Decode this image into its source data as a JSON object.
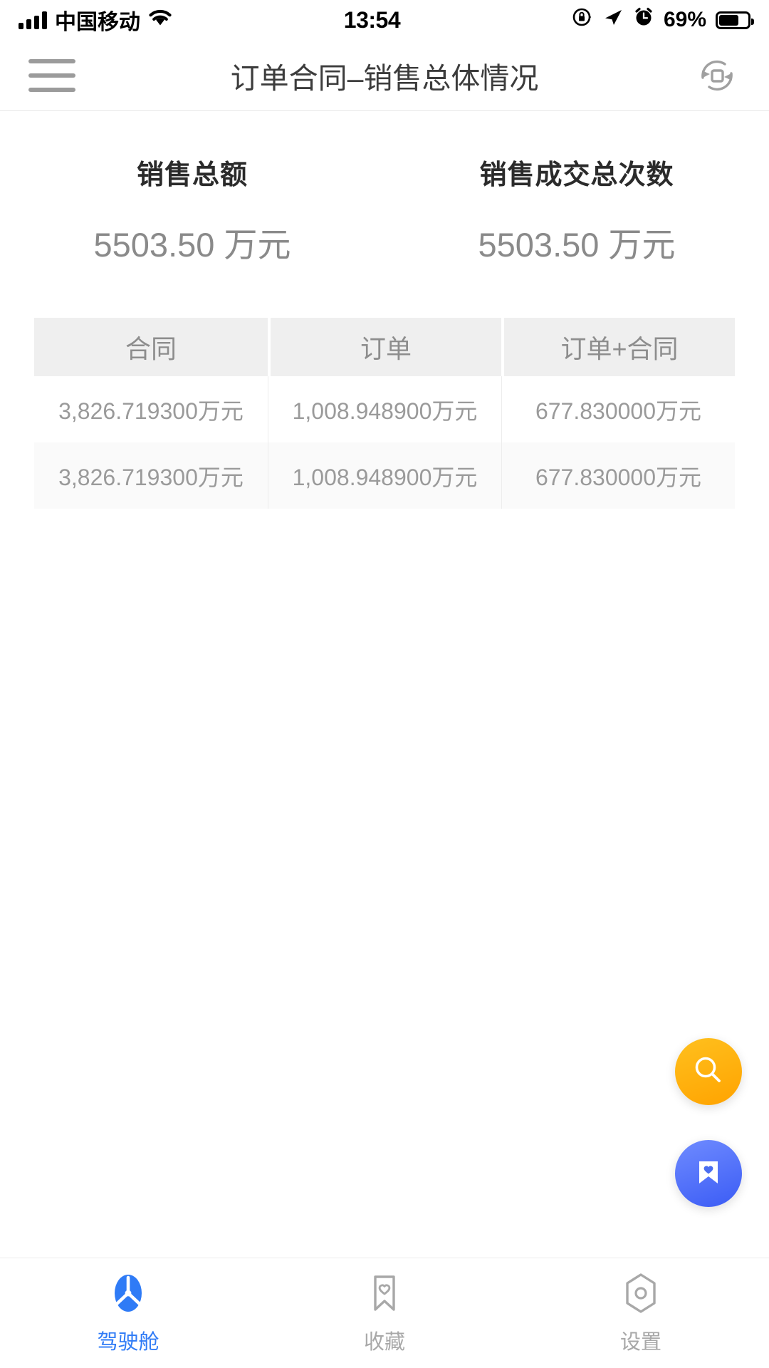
{
  "status_bar": {
    "carrier": "中国移动",
    "time": "13:54",
    "battery_percent": "69%",
    "icons": [
      "signal-bars-icon",
      "wifi-icon",
      "rotation-lock-icon",
      "location-arrow-icon",
      "alarm-clock-icon",
      "battery-icon"
    ]
  },
  "header": {
    "menu_icon": "hamburger-menu-icon",
    "title": "订单合同–销售总体情况",
    "rotate_icon": "screen-rotate-icon"
  },
  "kpis": [
    {
      "label": "销售总额",
      "value": "5503.50 万元"
    },
    {
      "label": "销售成交总次数",
      "value": "5503.50 万元"
    }
  ],
  "table": {
    "columns": [
      "合同",
      "订单",
      "订单+合同"
    ],
    "rows": [
      [
        "3,826.719300万元",
        "1,008.948900万元",
        "677.830000万元"
      ],
      [
        "3,826.719300万元",
        "1,008.948900万元",
        "677.830000万元"
      ]
    ]
  },
  "floating_buttons": [
    {
      "name": "search",
      "icon": "search-icon",
      "color": "#FFA300"
    },
    {
      "name": "collect",
      "icon": "bookmark-heart-icon",
      "color": "#3B5CF5"
    }
  ],
  "tabbar": {
    "active_color": "#2F7BF6",
    "inactive_color": "#A8A8A8",
    "items": [
      {
        "label": "驾驶舱",
        "icon": "cockpit-icon",
        "active": true
      },
      {
        "label": "收藏",
        "icon": "bookmark-heart-outline-icon",
        "active": false
      },
      {
        "label": "设置",
        "icon": "settings-hexagon-icon",
        "active": false
      }
    ]
  }
}
